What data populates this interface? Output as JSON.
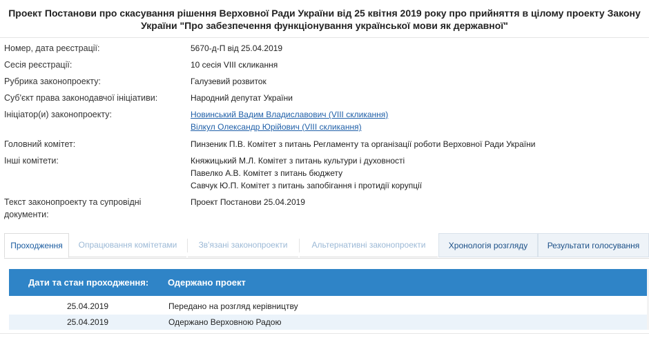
{
  "title": {
    "line1": "Проект Постанови про скасування рішення Верховної Ради України від 25 квітня 2019 року про прийняття в цілому проекту Закону",
    "line2": "України \"Про забезпечення функціонування української мови як державної\""
  },
  "info": {
    "reg_label": "Номер, дата реєстрації:",
    "reg_value": "5670-д-П від 25.04.2019",
    "session_label": "Сесія реєстрації:",
    "session_value": "10 сесія VIII скликання",
    "rubric_label": "Рубрика законопроекту:",
    "rubric_value": "Галузевий розвиток",
    "subject_label": "Суб'єкт права законодавчої ініціативи:",
    "subject_value": "Народний депутат України",
    "initiators_label": "Ініціатор(и) законопроекту:",
    "initiators": [
      "Новинський Вадим Владиславович (VIII скликання)",
      "Вілкул Олександр Юрійович (VIII скликання)"
    ],
    "main_committee_label": "Головний комітет:",
    "main_committee_value": "Пинзеник П.В. Комітет з питань Регламенту та організації роботи Верховної Ради України",
    "other_committees_label": "Інші комітети:",
    "other_committees": [
      "Княжицький М.Л. Комітет з питань культури і духовності",
      "Павелко А.В. Комітет з питань бюджету",
      "Савчук Ю.П. Комітет з питань запобігання і протидії корупції"
    ],
    "docs_label_line1": "Текст законопроекту та супровідні",
    "docs_label_line2": "документи:",
    "docs_value": "Проект Постанови 25.04.2019"
  },
  "tabs": [
    "Проходження",
    "Опрацювання комітетами",
    "Зв'язані законопроекти",
    "Альтернативні законопроекти",
    "Хронологія розгляду",
    "Результати голосування"
  ],
  "table": {
    "header_date": "Дати та стан проходження:",
    "header_status": "Одержано проект",
    "rows": [
      {
        "date": "25.04.2019",
        "status": "Передано на розгляд керівництву"
      },
      {
        "date": "25.04.2019",
        "status": "Одержано Верховною Радою"
      }
    ]
  }
}
